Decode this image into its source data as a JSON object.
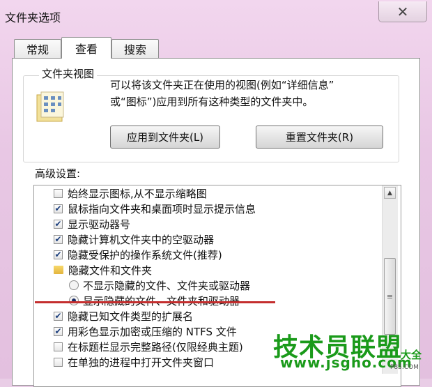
{
  "window": {
    "title": "文件夹选项",
    "close_glyph": "✕"
  },
  "tabs": [
    {
      "label": "常规",
      "active": false
    },
    {
      "label": "查看",
      "active": true
    },
    {
      "label": "搜索",
      "active": false
    }
  ],
  "folder_view": {
    "legend": "文件夹视图",
    "description_line1": "可以将该文件夹正在使用的视图(例如“详细信息”",
    "description_line2": "或“图标”)应用到所有这种类型的文件夹中。",
    "apply_button": "应用到文件夹(L)",
    "reset_button": "重置文件夹(R)",
    "icon": "folder-view-icon"
  },
  "advanced": {
    "label": "高级设置:",
    "items": [
      {
        "type": "checkbox",
        "checked": false,
        "label": "始终显示图标,从不显示缩略图"
      },
      {
        "type": "checkbox",
        "checked": true,
        "label": "鼠标指向文件夹和桌面项时显示提示信息"
      },
      {
        "type": "checkbox",
        "checked": true,
        "label": "显示驱动器号"
      },
      {
        "type": "checkbox",
        "checked": true,
        "label": "隐藏计算机文件夹中的空驱动器"
      },
      {
        "type": "checkbox",
        "checked": true,
        "label": "隐藏受保护的操作系统文件(推荐)"
      },
      {
        "type": "folder",
        "label": "隐藏文件和文件夹"
      },
      {
        "type": "radio",
        "checked": false,
        "label": "不显示隐藏的文件、文件夹或驱动器"
      },
      {
        "type": "radio",
        "checked": true,
        "label": "显示隐藏的文件、文件夹和驱动器"
      },
      {
        "type": "checkbox",
        "checked": true,
        "label": "隐藏已知文件类型的扩展名"
      },
      {
        "type": "checkbox",
        "checked": true,
        "label": "用彩色显示加密或压缩的 NTFS 文件"
      },
      {
        "type": "checkbox",
        "checked": false,
        "label": "在标题栏显示完整路径(仅限经典主题)"
      },
      {
        "type": "checkbox",
        "checked": false,
        "label": "在单独的进程中打开文件夹窗口"
      }
    ]
  },
  "watermark": {
    "title": "技术员联盟",
    "url": "www.jsgho.com",
    "side": "大全",
    "small": "P85.COM"
  },
  "colors": {
    "annotation_underline": "#c42e2e",
    "watermark": "#1a9a1a"
  }
}
